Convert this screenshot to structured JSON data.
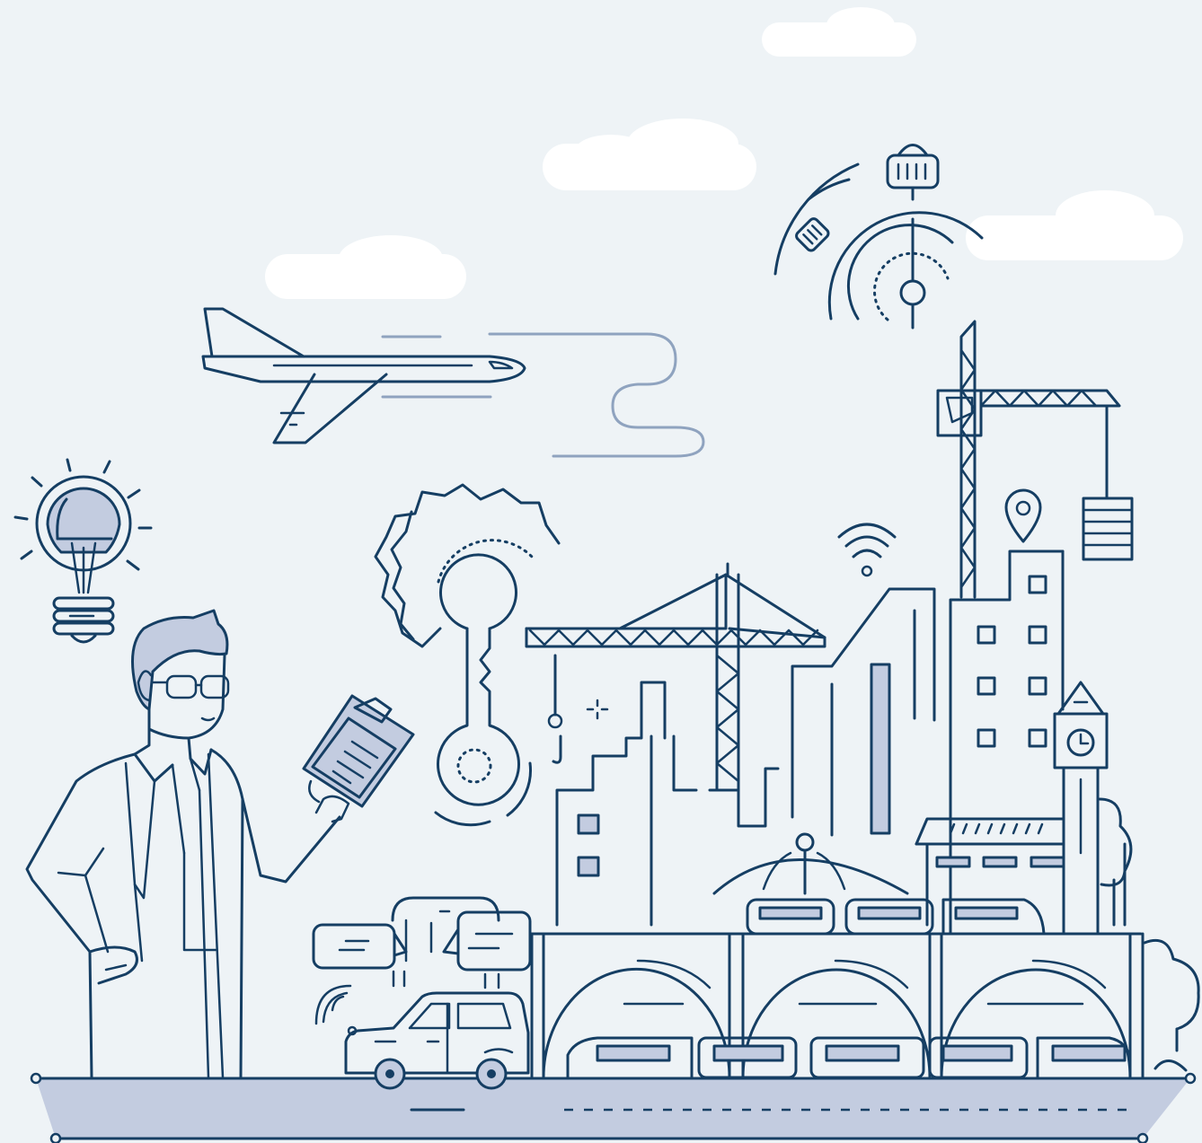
{
  "scene": {
    "colors": {
      "background": "#eef3f6",
      "line": "#153e63",
      "fill": "#c3cce0",
      "trail": "#8fa3bf",
      "cloud": "#ffffff"
    },
    "icons": [
      "lightbulb-icon",
      "airplane-icon",
      "gear-key-icon",
      "stopwatch-icon",
      "tower-crane-icon",
      "wifi-icon",
      "location-pin-icon",
      "clock-tower-icon",
      "car-icon",
      "chat-bubbles-icon",
      "train-icon",
      "clipboard-icon"
    ]
  }
}
